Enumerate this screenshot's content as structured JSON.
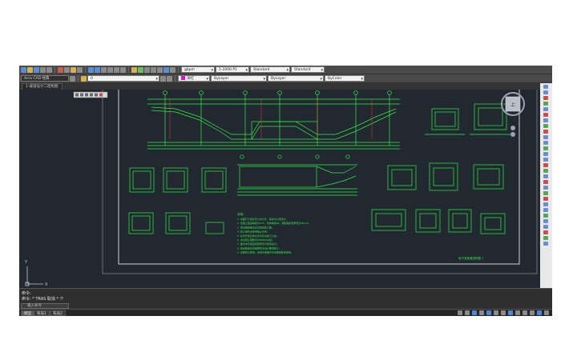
{
  "toolbar": {
    "workspace": "Acro CAD 经典",
    "layer_name": "0",
    "text_style": "gbpm",
    "dim_style": "1-2000 P1",
    "table_style": "Standard",
    "mleader_style": "Standard",
    "color": "洋红",
    "linetype": "ByLayer",
    "lineweight": "ByLayer",
    "plot_style": "ByColor"
  },
  "tab": {
    "label": "1-坡道设计二结构图"
  },
  "drawing": {
    "title_block_text": "地下室坡道结构图  1",
    "notes_heading": "说明:",
    "notes": [
      "1. 本图尺寸除标高以米计外，其余均以毫米计。",
      "2. 混凝土强度等级为C35，抗渗等级P6，钢筋保护层厚度为50mm。",
      "3. 坡道面层做法详见建筑施工图。",
      "4. 施工缝处设置钢板止水带。",
      "5. 基坑开挖及降水详见有关施工方案。",
      "6. 未注明之钢筋均为HRB400级。",
      "7. 图中未尽事宜按国家现行规范执行。",
      "8. 坡道底板及侧墙按防水设计要求施工。",
      "9. 本图须与建筑、给排水等相关专业图纸配合使用。"
    ],
    "viewcube_label": "上"
  },
  "command": {
    "line1": "命令:",
    "line2": "命令: * TRAS 取消 * 个",
    "input_placeholder": "输入命令"
  },
  "status": {
    "tabs": [
      "模型",
      "布局1",
      "布局2"
    ],
    "active_tab": "模型"
  },
  "colors": {
    "canvas_bg": "#212830",
    "drawing_line": "#37e84a",
    "frame": "#ffffff",
    "accent": "#e000e0"
  }
}
